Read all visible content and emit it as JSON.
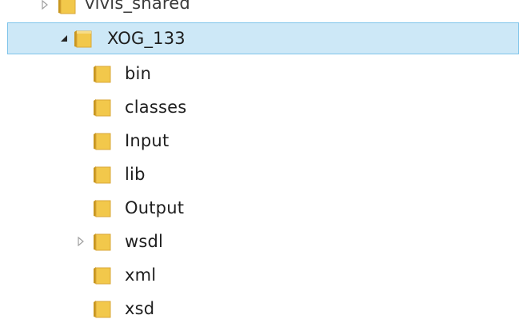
{
  "tree": {
    "partial_item": {
      "label": "vivis_snared"
    },
    "selected_item": {
      "label": "XOG_133",
      "expanded": true
    },
    "children": [
      {
        "label": "bin",
        "expandable": false
      },
      {
        "label": "classes",
        "expandable": false
      },
      {
        "label": "Input",
        "expandable": false
      },
      {
        "label": "lib",
        "expandable": false
      },
      {
        "label": "Output",
        "expandable": false
      },
      {
        "label": "wsdl",
        "expandable": true
      },
      {
        "label": "xml",
        "expandable": false
      },
      {
        "label": "xsd",
        "expandable": false
      }
    ]
  },
  "colors": {
    "selection_fill": "#cde8f7",
    "selection_border": "#7fc4ea",
    "folder_yellow": "#f2c84b",
    "folder_dark": "#c8961e"
  }
}
